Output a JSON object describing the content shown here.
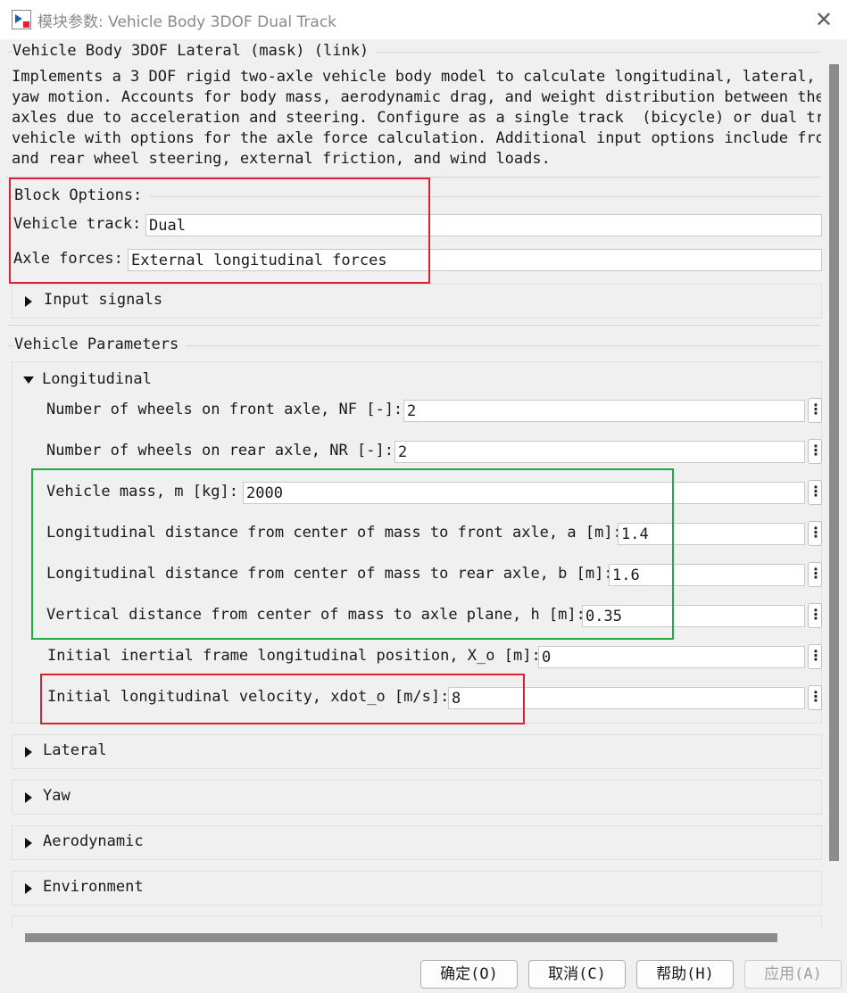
{
  "window": {
    "title": "模块参数: Vehicle Body 3DOF Dual Track",
    "icon": "simulink-block-icon",
    "close": "close-icon"
  },
  "mask": {
    "legend": "Vehicle Body 3DOF Lateral (mask) (link)",
    "description": [
      "Implements a 3 DOF rigid two-axle vehicle body model to calculate longitudinal, lateral, and",
      "yaw motion. Accounts for body mass, aerodynamic drag, and weight distribution between the",
      "axles due to acceleration and steering. Configure as a single track  (bicycle) or dual track",
      "vehicle with options for the axle force calculation. Additional input options include front",
      "and rear wheel steering, external friction, and wind loads."
    ]
  },
  "block_options": {
    "legend": "Block Options:",
    "vehicle_track_label": "Vehicle track:",
    "vehicle_track_value": "Dual",
    "axle_forces_label": "Axle forces:",
    "axle_forces_value": "External longitudinal forces",
    "input_signals": "Input signals"
  },
  "vehicle_parameters": {
    "legend": "Vehicle Parameters",
    "longitudinal": {
      "title": "Longitudinal",
      "params": [
        {
          "label": "Number of wheels on front axle, NF [-]:",
          "value": "2"
        },
        {
          "label": "Number of wheels on rear axle, NR [-]:",
          "value": "2"
        },
        {
          "label": "Vehicle mass, m [kg]:",
          "value": "2000"
        },
        {
          "label": "Longitudinal distance from center of mass to front axle, a [m]:",
          "value": "1.4"
        },
        {
          "label": "Longitudinal distance from center of mass to rear axle, b [m]:",
          "value": "1.6"
        },
        {
          "label": "Vertical distance from center of mass to axle plane, h [m]:",
          "value": "0.35"
        },
        {
          "label": "Initial inertial frame longitudinal position, X_o [m]:",
          "value": "0"
        },
        {
          "label": "Initial longitudinal velocity, xdot_o [m/s]:",
          "value": "8"
        }
      ]
    },
    "collapsed_sections": [
      "Lateral",
      "Yaw",
      "Aerodynamic",
      "Environment"
    ]
  },
  "buttons": {
    "ok": "确定(O)",
    "cancel": "取消(C)",
    "help": "帮助(H)",
    "apply": "应用(A)"
  },
  "colors": {
    "highlight_red": "#e02030",
    "highlight_green": "#22aa44"
  }
}
